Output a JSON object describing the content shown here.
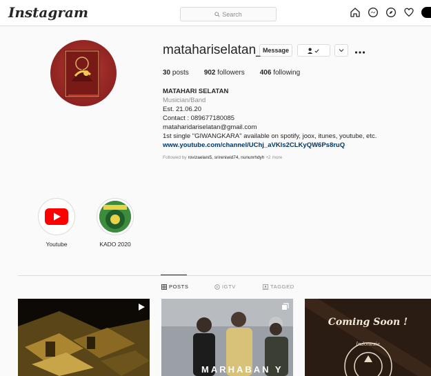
{
  "header": {
    "logo": "Instagram",
    "search_placeholder": "Search",
    "nav_icons": [
      "home-icon",
      "messenger-icon",
      "explore-icon",
      "heart-icon",
      "profile-avatar"
    ]
  },
  "profile": {
    "username": "matahariselatan_",
    "message_label": "Message",
    "follow_icon": "person-check-icon",
    "dropdown_icon": "chevron-down-icon",
    "more_icon": "ellipsis-icon",
    "stats": [
      {
        "count": "30",
        "label": "posts"
      },
      {
        "count": "902",
        "label": "followers"
      },
      {
        "count": "406",
        "label": "following"
      }
    ],
    "bio": {
      "name": "MATAHARI SELATAN",
      "category": "Musician/Band",
      "lines": [
        "Est. 21.06.20",
        "Contact : 089677180085",
        "mataharidariselatan@gmail.com",
        "1st single \"GIWANGKARA\" available on spotify, joox, itunes, youtube, etc."
      ],
      "link": "www.youtube.com/channel/UChj_aVKls2CLKyQW6Ps8ruQ",
      "followed_prefix": "Followed by",
      "followed_users": "rovizaelani5, srireniwid74, nununrhdyh",
      "followed_more": "+2 more"
    }
  },
  "highlights": [
    {
      "label": "Youtube",
      "icon": "youtube-icon"
    },
    {
      "label": "KADO 2020",
      "icon": "kado-2020-cover"
    }
  ],
  "tabs": [
    {
      "label": "POSTS",
      "icon": "grid-icon",
      "active": true
    },
    {
      "label": "IGTV",
      "icon": "igtv-icon",
      "active": false
    },
    {
      "label": "TAGGED",
      "icon": "tagged-icon",
      "active": false
    }
  ],
  "posts": [
    {
      "type": "video",
      "badge": "play-icon"
    },
    {
      "type": "carousel",
      "badge": "carousel-icon",
      "overlay_text": "MARHABAN Y"
    },
    {
      "type": "image",
      "overlay_text": "Coming Soon !",
      "sub_text": "Indonesia"
    }
  ],
  "colors": {
    "background": "#fafafa",
    "border": "#dbdbdb",
    "link": "#00376b",
    "muted": "#8e8e8e",
    "avatar_red": "#9a2a25",
    "youtube_red": "#ff0000"
  }
}
